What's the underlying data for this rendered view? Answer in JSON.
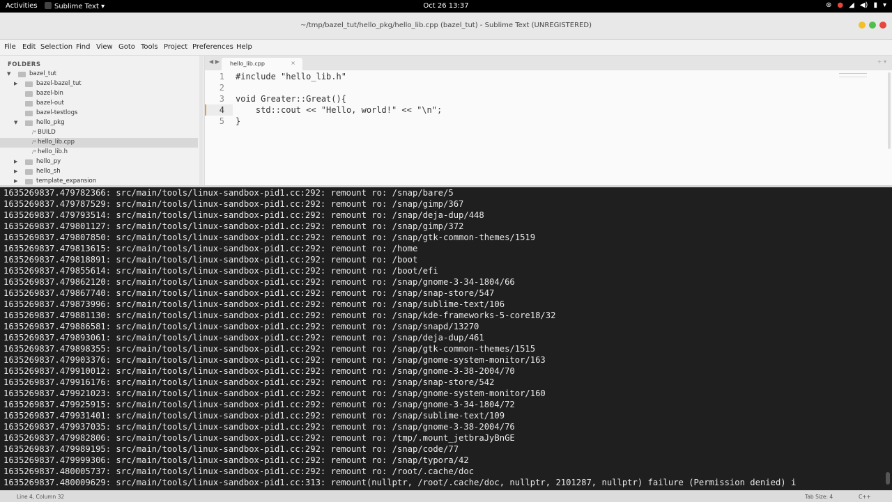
{
  "topbar": {
    "activities": "Activities",
    "app_name": "Sublime Text ▾",
    "clock": "Oct 26  13:37",
    "tray": [
      "⊛",
      "●",
      "◢",
      "◀)",
      "▮",
      "▾"
    ]
  },
  "window": {
    "title": "~/tmp/bazel_tut/hello_pkg/hello_lib.cpp (bazel_tut) - Sublime Text (UNREGISTERED)",
    "button_colors": [
      "#f4bf2a",
      "#4fbf4a",
      "#e8463c"
    ]
  },
  "menu": [
    "File",
    "Edit",
    "Selection",
    "Find",
    "View",
    "Goto",
    "Tools",
    "Project",
    "Preferences",
    "Help"
  ],
  "sidebar": {
    "header": "FOLDERS",
    "items": [
      {
        "label": "bazel_tut",
        "kind": "folder",
        "depth": 0,
        "arrow": "▼",
        "selected": false
      },
      {
        "label": "bazel-bazel_tut",
        "kind": "folder",
        "depth": 1,
        "arrow": "▶",
        "selected": false
      },
      {
        "label": "bazel-bin",
        "kind": "folder",
        "depth": 1,
        "arrow": "",
        "selected": false
      },
      {
        "label": "bazel-out",
        "kind": "folder",
        "depth": 1,
        "arrow": "",
        "selected": false
      },
      {
        "label": "bazel-testlogs",
        "kind": "folder",
        "depth": 1,
        "arrow": "",
        "selected": false
      },
      {
        "label": "hello_pkg",
        "kind": "folder",
        "depth": 1,
        "arrow": "▼",
        "selected": false
      },
      {
        "label": "BUILD",
        "kind": "file",
        "depth": 2,
        "arrow": "",
        "selected": false
      },
      {
        "label": "hello_lib.cpp",
        "kind": "file",
        "depth": 2,
        "arrow": "",
        "selected": true
      },
      {
        "label": "hello_lib.h",
        "kind": "file",
        "depth": 2,
        "arrow": "",
        "selected": false
      },
      {
        "label": "hello_py",
        "kind": "folder",
        "depth": 1,
        "arrow": "▶",
        "selected": false
      },
      {
        "label": "hello_sh",
        "kind": "folder",
        "depth": 1,
        "arrow": "▶",
        "selected": false
      },
      {
        "label": "template_expansion",
        "kind": "folder",
        "depth": 1,
        "arrow": "▶",
        "selected": false
      }
    ]
  },
  "editor": {
    "nav_arrows": "◀ ▶",
    "tab": {
      "label": "hello_lib.cpp",
      "close": "×"
    },
    "tab_actions": "+ ▾",
    "current_line": 4,
    "lines": [
      {
        "n": "1",
        "text": "#include \"hello_lib.h\""
      },
      {
        "n": "2",
        "text": ""
      },
      {
        "n": "3",
        "text": "void Greater::Great(){"
      },
      {
        "n": "4",
        "text": "    std::cout << \"Hello, world!\" << \"\\n\";"
      },
      {
        "n": "5",
        "text": "}"
      }
    ]
  },
  "console": {
    "lines": [
      "1635269837.479782366: src/main/tools/linux-sandbox-pid1.cc:292: remount ro: /snap/bare/5",
      "1635269837.479787529: src/main/tools/linux-sandbox-pid1.cc:292: remount ro: /snap/gimp/367",
      "1635269837.479793514: src/main/tools/linux-sandbox-pid1.cc:292: remount ro: /snap/deja-dup/448",
      "1635269837.479801127: src/main/tools/linux-sandbox-pid1.cc:292: remount ro: /snap/gimp/372",
      "1635269837.479807850: src/main/tools/linux-sandbox-pid1.cc:292: remount ro: /snap/gtk-common-themes/1519",
      "1635269837.479813615: src/main/tools/linux-sandbox-pid1.cc:292: remount ro: /home",
      "1635269837.479818891: src/main/tools/linux-sandbox-pid1.cc:292: remount ro: /boot",
      "1635269837.479855614: src/main/tools/linux-sandbox-pid1.cc:292: remount ro: /boot/efi",
      "1635269837.479862120: src/main/tools/linux-sandbox-pid1.cc:292: remount ro: /snap/gnome-3-34-1804/66",
      "1635269837.479867740: src/main/tools/linux-sandbox-pid1.cc:292: remount ro: /snap/snap-store/547",
      "1635269837.479873996: src/main/tools/linux-sandbox-pid1.cc:292: remount ro: /snap/sublime-text/106",
      "1635269837.479881130: src/main/tools/linux-sandbox-pid1.cc:292: remount ro: /snap/kde-frameworks-5-core18/32",
      "1635269837.479886581: src/main/tools/linux-sandbox-pid1.cc:292: remount ro: /snap/snapd/13270",
      "1635269837.479893061: src/main/tools/linux-sandbox-pid1.cc:292: remount ro: /snap/deja-dup/461",
      "1635269837.479898355: src/main/tools/linux-sandbox-pid1.cc:292: remount ro: /snap/gtk-common-themes/1515",
      "1635269837.479903376: src/main/tools/linux-sandbox-pid1.cc:292: remount ro: /snap/gnome-system-monitor/163",
      "1635269837.479910012: src/main/tools/linux-sandbox-pid1.cc:292: remount ro: /snap/gnome-3-38-2004/70",
      "1635269837.479916176: src/main/tools/linux-sandbox-pid1.cc:292: remount ro: /snap/snap-store/542",
      "1635269837.479921023: src/main/tools/linux-sandbox-pid1.cc:292: remount ro: /snap/gnome-system-monitor/160",
      "1635269837.479925915: src/main/tools/linux-sandbox-pid1.cc:292: remount ro: /snap/gnome-3-34-1804/72",
      "1635269837.479931401: src/main/tools/linux-sandbox-pid1.cc:292: remount ro: /snap/sublime-text/109",
      "1635269837.479937035: src/main/tools/linux-sandbox-pid1.cc:292: remount ro: /snap/gnome-3-38-2004/76",
      "1635269837.479982806: src/main/tools/linux-sandbox-pid1.cc:292: remount ro: /tmp/.mount_jetbraJyBnGE",
      "1635269837.479989195: src/main/tools/linux-sandbox-pid1.cc:292: remount ro: /snap/code/77",
      "1635269837.479999306: src/main/tools/linux-sandbox-pid1.cc:292: remount ro: /snap/typora/42",
      "1635269837.480005737: src/main/tools/linux-sandbox-pid1.cc:292: remount ro: /root/.cache/doc",
      "1635269837.480009629: src/main/tools/linux-sandbox-pid1.cc:313: remount(nullptr, /root/.cache/doc, nullptr, 2101287, nullptr) failure (Permission denied) i"
    ]
  },
  "status": {
    "position": "Line 4, Column 32",
    "tab_size": "Tab Size: 4",
    "syntax": "C++"
  },
  "colors": {
    "console_bg": "#1f1f1f",
    "keyword": "#a4a4a4",
    "string": "#3f3f3f",
    "accent_marker": "#f29a2c"
  }
}
